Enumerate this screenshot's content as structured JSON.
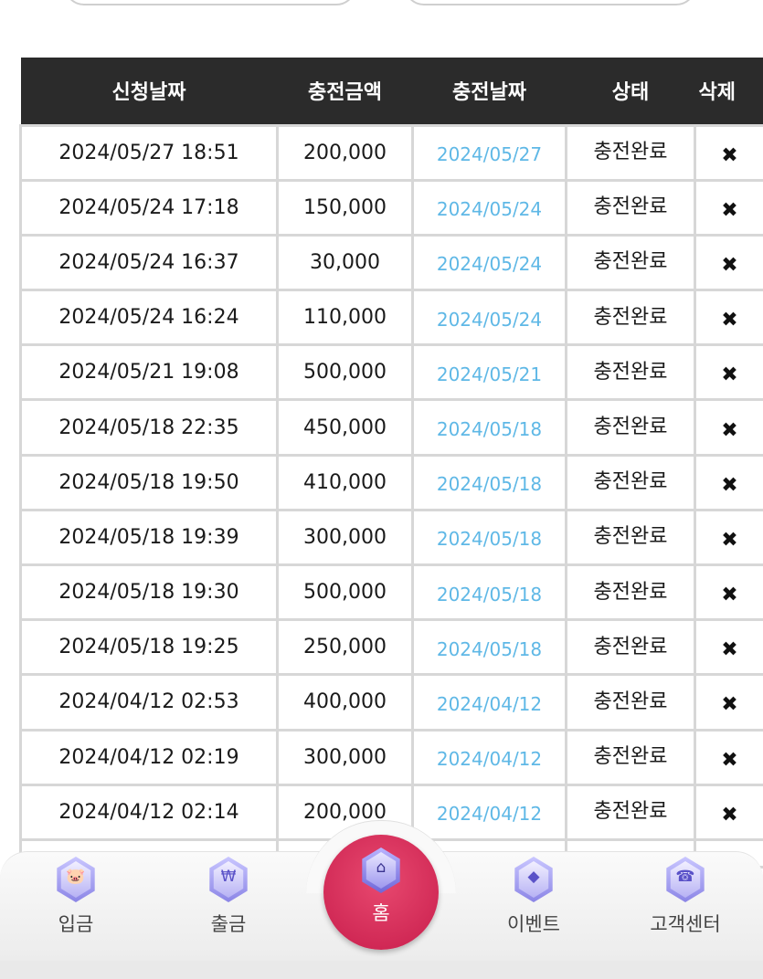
{
  "table": {
    "headers": [
      "신청날짜",
      "충전금액",
      "충전날짜",
      "상태",
      "삭제"
    ],
    "rows": [
      {
        "requested": "2024/05/27 18:51",
        "amount": "200,000",
        "charged": "2024/05/27",
        "status": "충전완료",
        "delete": "✖"
      },
      {
        "requested": "2024/05/24 17:18",
        "amount": "150,000",
        "charged": "2024/05/24",
        "status": "충전완료",
        "delete": "✖"
      },
      {
        "requested": "2024/05/24 16:37",
        "amount": "30,000",
        "charged": "2024/05/24",
        "status": "충전완료",
        "delete": "✖"
      },
      {
        "requested": "2024/05/24 16:24",
        "amount": "110,000",
        "charged": "2024/05/24",
        "status": "충전완료",
        "delete": "✖"
      },
      {
        "requested": "2024/05/21 19:08",
        "amount": "500,000",
        "charged": "2024/05/21",
        "status": "충전완료",
        "delete": "✖"
      },
      {
        "requested": "2024/05/18 22:35",
        "amount": "450,000",
        "charged": "2024/05/18",
        "status": "충전완료",
        "delete": "✖"
      },
      {
        "requested": "2024/05/18 19:50",
        "amount": "410,000",
        "charged": "2024/05/18",
        "status": "충전완료",
        "delete": "✖"
      },
      {
        "requested": "2024/05/18 19:39",
        "amount": "300,000",
        "charged": "2024/05/18",
        "status": "충전완료",
        "delete": "✖"
      },
      {
        "requested": "2024/05/18 19:30",
        "amount": "500,000",
        "charged": "2024/05/18",
        "status": "충전완료",
        "delete": "✖"
      },
      {
        "requested": "2024/05/18 19:25",
        "amount": "250,000",
        "charged": "2024/05/18",
        "status": "충전완료",
        "delete": "✖"
      },
      {
        "requested": "2024/04/12 02:53",
        "amount": "400,000",
        "charged": "2024/04/12",
        "status": "충전완료",
        "delete": "✖"
      },
      {
        "requested": "2024/04/12 02:19",
        "amount": "300,000",
        "charged": "2024/04/12",
        "status": "충전완료",
        "delete": "✖"
      },
      {
        "requested": "2024/04/12 02:14",
        "amount": "200,000",
        "charged": "2024/04/12",
        "status": "충전완료",
        "delete": "✖"
      }
    ]
  },
  "nav": {
    "items": [
      {
        "label": "입금",
        "icon": "piggy-bank-icon",
        "glyph": "🐷"
      },
      {
        "label": "출금",
        "icon": "money-bag-icon",
        "glyph": "₩"
      },
      {
        "label": "홈",
        "icon": "home-icon",
        "glyph": "⌂"
      },
      {
        "label": "이벤트",
        "icon": "diamond-icon",
        "glyph": "◆"
      },
      {
        "label": "고객센터",
        "icon": "customer-support-icon",
        "glyph": "☎"
      }
    ]
  },
  "colors": {
    "header_bg": "#2b2b2b",
    "charged_date": "#5fb8e6",
    "home_button": "#d12b57",
    "icon_hex": "#8b85e6"
  }
}
